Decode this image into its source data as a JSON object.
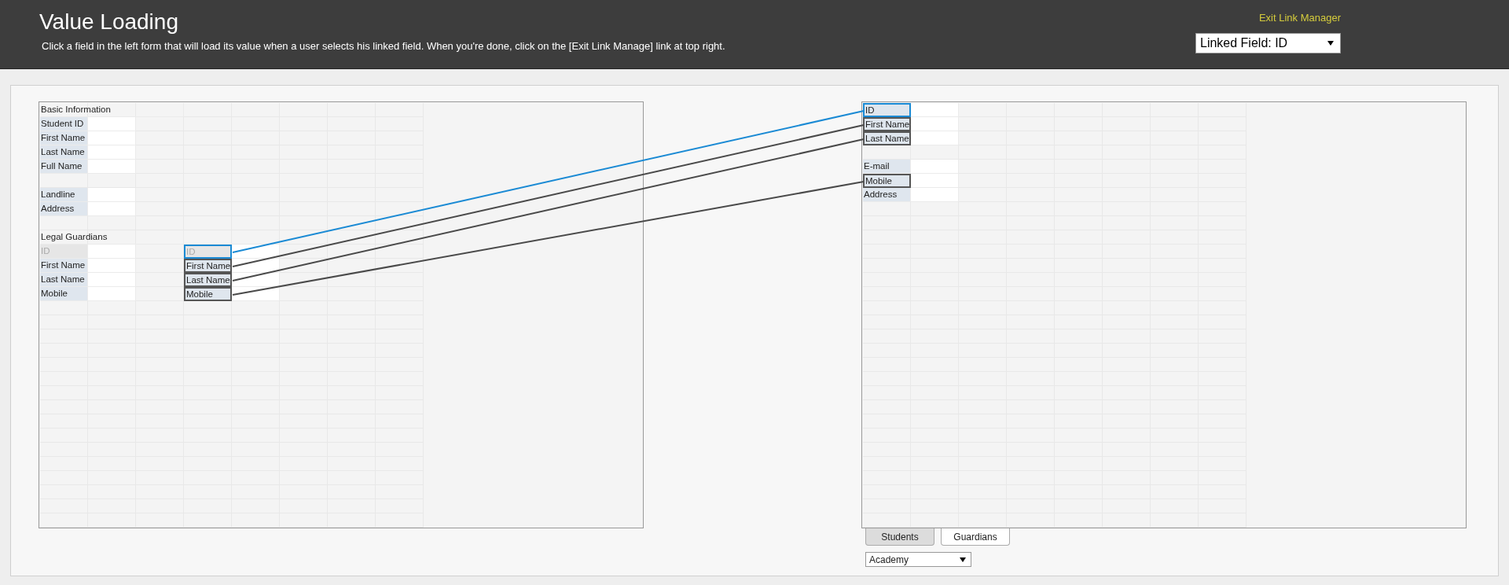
{
  "header": {
    "title": "Value Loading",
    "instructions": "Click a field in the left form that will load its value when a user selects his linked field. When you're done, click on the [Exit Link Manage] link at top right.",
    "exit_link": "Exit Link Manager",
    "linked_field_select": {
      "value": "Linked Field: ID"
    }
  },
  "left_form": {
    "rows": [
      {
        "cells": [
          {
            "kind": "heading",
            "text": "Basic Information"
          }
        ]
      },
      {
        "cells": [
          {
            "kind": "label",
            "text": "Student ID",
            "disabled": false,
            "linked": false,
            "selected": false
          },
          {
            "kind": "input"
          }
        ]
      },
      {
        "cells": [
          {
            "kind": "label",
            "text": "First Name",
            "disabled": false,
            "linked": false,
            "selected": false
          },
          {
            "kind": "input"
          }
        ]
      },
      {
        "cells": [
          {
            "kind": "label",
            "text": "Last Name",
            "disabled": false,
            "linked": false,
            "selected": false
          },
          {
            "kind": "input"
          }
        ]
      },
      {
        "cells": [
          {
            "kind": "label",
            "text": "Full Name",
            "disabled": false,
            "linked": false,
            "selected": false
          },
          {
            "kind": "input"
          }
        ]
      },
      {
        "cells": []
      },
      {
        "cells": [
          {
            "kind": "label",
            "text": "Landline",
            "disabled": false,
            "linked": false,
            "selected": false
          },
          {
            "kind": "input"
          }
        ]
      },
      {
        "cells": [
          {
            "kind": "label",
            "text": "Address",
            "disabled": false,
            "linked": false,
            "selected": false
          },
          {
            "kind": "input"
          }
        ]
      },
      {
        "cells": []
      },
      {
        "cells": [
          {
            "kind": "heading",
            "text": "Legal Guardians"
          }
        ]
      },
      {
        "cells": [
          {
            "kind": "label",
            "text": "ID",
            "disabled": true,
            "linked": false,
            "selected": false
          },
          {
            "kind": "input"
          },
          {
            "kind": "blank"
          },
          {
            "kind": "label",
            "text": "ID",
            "disabled": true,
            "linked": true,
            "selected": true
          },
          {
            "kind": "input"
          }
        ]
      },
      {
        "cells": [
          {
            "kind": "label",
            "text": "First Name",
            "disabled": false,
            "linked": false,
            "selected": false
          },
          {
            "kind": "input"
          },
          {
            "kind": "blank"
          },
          {
            "kind": "label",
            "text": "First Name",
            "disabled": false,
            "linked": true,
            "selected": false
          },
          {
            "kind": "input"
          }
        ]
      },
      {
        "cells": [
          {
            "kind": "label",
            "text": "Last Name",
            "disabled": false,
            "linked": false,
            "selected": false
          },
          {
            "kind": "input"
          },
          {
            "kind": "blank"
          },
          {
            "kind": "label",
            "text": "Last Name",
            "disabled": false,
            "linked": true,
            "selected": false
          },
          {
            "kind": "input"
          }
        ]
      },
      {
        "cells": [
          {
            "kind": "label",
            "text": "Mobile",
            "disabled": false,
            "linked": false,
            "selected": false
          },
          {
            "kind": "input"
          },
          {
            "kind": "blank"
          },
          {
            "kind": "label",
            "text": "Mobile",
            "disabled": false,
            "linked": true,
            "selected": false
          },
          {
            "kind": "input"
          }
        ]
      }
    ]
  },
  "right_form": {
    "rows": [
      {
        "cells": [
          {
            "kind": "label",
            "text": "ID",
            "disabled": false,
            "linked": true,
            "selected": true
          },
          {
            "kind": "input"
          }
        ]
      },
      {
        "cells": [
          {
            "kind": "label",
            "text": "First Name",
            "disabled": false,
            "linked": true,
            "selected": false
          },
          {
            "kind": "input"
          }
        ]
      },
      {
        "cells": [
          {
            "kind": "label",
            "text": "Last Name",
            "disabled": false,
            "linked": true,
            "selected": false
          },
          {
            "kind": "input"
          }
        ]
      },
      {
        "cells": []
      },
      {
        "cells": [
          {
            "kind": "label",
            "text": "E-mail",
            "disabled": false,
            "linked": false,
            "selected": false
          },
          {
            "kind": "input"
          }
        ]
      },
      {
        "cells": [
          {
            "kind": "label",
            "text": "Mobile",
            "disabled": false,
            "linked": true,
            "selected": false
          },
          {
            "kind": "input"
          }
        ]
      },
      {
        "cells": [
          {
            "kind": "label",
            "text": "Address",
            "disabled": false,
            "linked": false,
            "selected": false
          },
          {
            "kind": "input"
          }
        ]
      }
    ],
    "tabs": [
      {
        "label": "Students",
        "selected": true
      },
      {
        "label": "Guardians",
        "selected": false
      }
    ],
    "source_select": {
      "value": "Academy"
    }
  }
}
